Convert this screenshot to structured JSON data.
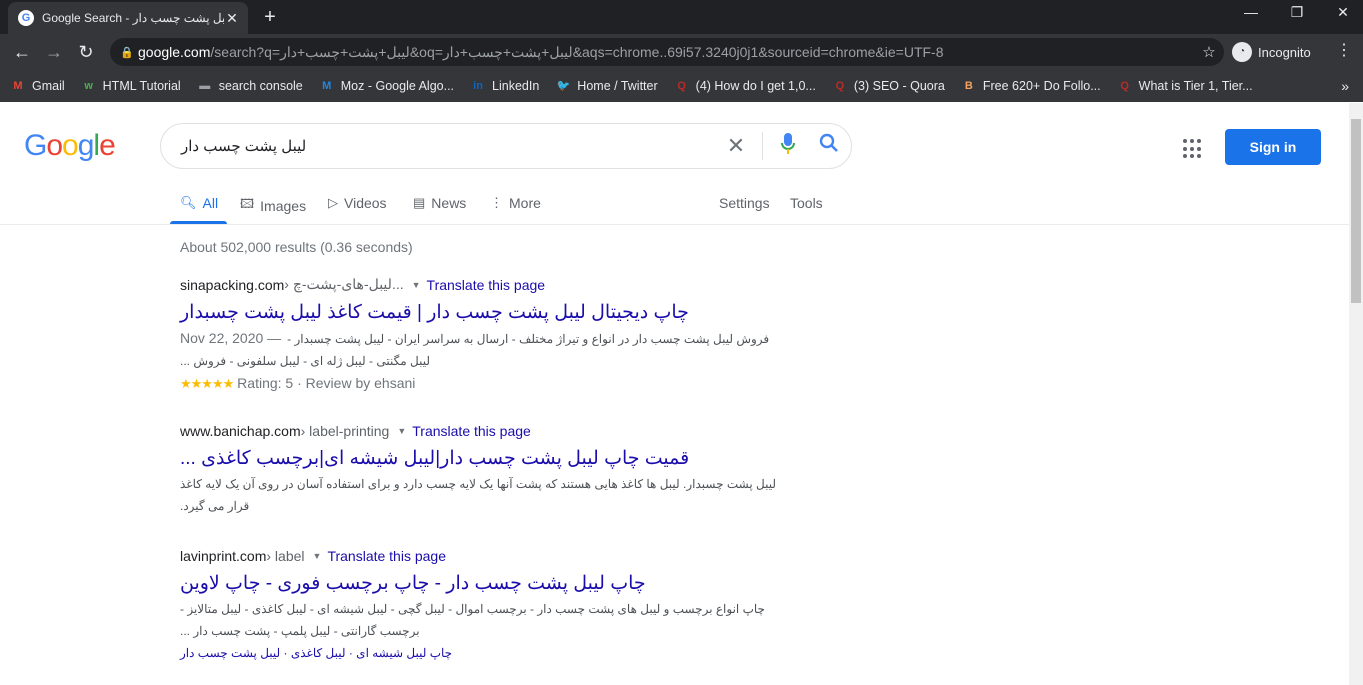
{
  "browser": {
    "tab_title": "Google Search - لیبل پشت چسب دار",
    "tab_favicon": "G",
    "url_host": "google.com",
    "url_rest": "/search?q=لیبل+پشت+چسب+دار&oq=لیبل+پشت+چسب+دار&aqs=chrome..69i57.3240j0j1&sourceid=chrome&ie=UTF-8",
    "profile_label": "Incognito",
    "bookmarks": [
      {
        "label": "Gmail",
        "icon": "M",
        "color": "#ea4335"
      },
      {
        "label": "HTML Tutorial",
        "icon": "w",
        "color": "#4caf50"
      },
      {
        "label": "search console",
        "icon": "▬",
        "color": "#9aa0a6"
      },
      {
        "label": "Moz - Google Algo...",
        "icon": "M",
        "color": "#1e88e5"
      },
      {
        "label": "LinkedIn",
        "icon": "in",
        "color": "#0a66c2"
      },
      {
        "label": "Home / Twitter",
        "icon": "🐦",
        "color": "#1da1f2"
      },
      {
        "label": "(4) How do I get 1,0...",
        "icon": "Q",
        "color": "#b92b27"
      },
      {
        "label": "(3) SEO - Quora",
        "icon": "Q",
        "color": "#b92b27"
      },
      {
        "label": "Free 620+ Do Follo...",
        "icon": "B",
        "color": "#f4a261"
      },
      {
        "label": "What is Tier 1, Tier...",
        "icon": "Q",
        "color": "#b92b27"
      }
    ]
  },
  "google": {
    "logo_letters": [
      {
        "ch": "G",
        "color": "#4285f4"
      },
      {
        "ch": "o",
        "color": "#ea4335"
      },
      {
        "ch": "o",
        "color": "#fbbc05"
      },
      {
        "ch": "g",
        "color": "#4285f4"
      },
      {
        "ch": "l",
        "color": "#34a853"
      },
      {
        "ch": "e",
        "color": "#ea4335"
      }
    ],
    "query": "لیبل پشت چسب دار",
    "sign_in": "Sign in",
    "tabs": {
      "all": "All",
      "images": "Images",
      "videos": "Videos",
      "news": "News",
      "more": "More",
      "settings": "Settings",
      "tools": "Tools"
    },
    "stats": "About 502,000 results (0.36 seconds)",
    "results": [
      {
        "host": "sinapacking.com",
        "path": " › لیبل-های-پشت-چ...",
        "translate": "Translate this page",
        "title": "چاپ دیجیتال لیبل پشت چسب دار | قیمت کاغذ لیبل پشت چسبدار",
        "date": "Nov 22, 2020 —",
        "snippet": "فروش لیبل پشت چسب دار در انواع و تیراژ مختلف - ارسال به سراسر ایران - لیبل پشت چسبدار - لیبل مگنتی - لیبل ژله ای - لیبل سلفونی - فروش ...",
        "stars": "★★★★★",
        "rating": "Rating: 5 · Review by ehsani"
      },
      {
        "host": "www.banichap.com",
        "path": " › label-printing",
        "translate": "Translate this page",
        "title": "قمیت چاپ لیبل پشت چسب دار|لیبل شیشه ای|برچسب کاغذی ...",
        "snippet": "لیبل پشت چسبدار. لیبل ها کاغذ هایی هستند که پشت آنها یک لایه چسب دارد و برای استفاده آسان در روی آن یک لایه کاغذ قرار می گیرد."
      },
      {
        "host": "lavinprint.com",
        "path": " › label",
        "translate": "Translate this page",
        "title": "چاپ لیبل پشت چسب دار - چاپ برچسب فوری - چاپ لاوین",
        "snippet": "چاپ انواع برچسب و لیبل های پشت چسب دار - برچسب اموال - لیبل گچی - لیبل شیشه ای - لیبل کاغذی - لیبل متالایز - برچسب گارانتی - لیبل پلمپ - پشت چسب دار ...",
        "sitelinks": "چاپ لیبل شیشه ای · لیبل کاغذی · لیبل پشت چسب دار"
      }
    ]
  }
}
